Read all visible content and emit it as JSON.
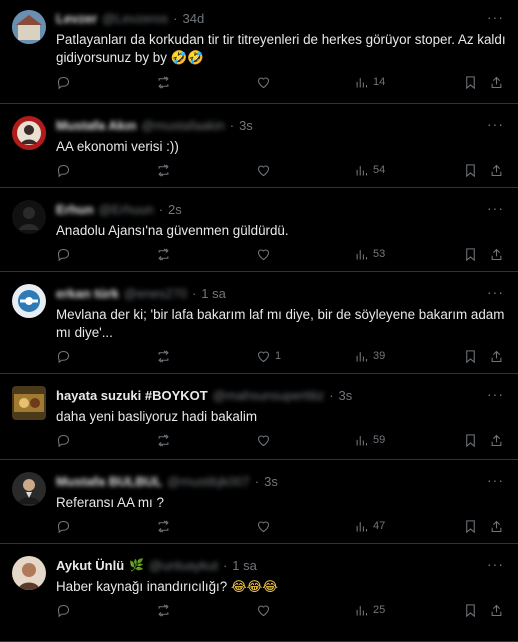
{
  "tweets": [
    {
      "name": "Levzer",
      "handle": "@Levzeros",
      "time": "34d",
      "text": "Patlayanları da korkudan tir tir titreyenleri de herkes görüyor stoper. Az kaldı gidiyorsunuz by by",
      "emoji": "🤣🤣",
      "likes": "",
      "views": "14",
      "avatar_color": "#3b5d7a"
    },
    {
      "name": "Mustafa Akın",
      "handle": "@mustafaakin",
      "time": "3s",
      "text": "AA ekonomi verisi :))",
      "emoji": "",
      "likes": "",
      "views": "54",
      "avatar_color": "#b11b1b"
    },
    {
      "name": "Erhun",
      "handle": "@Erhuun",
      "time": "2s",
      "text": "Anadolu Ajansı'na güvenmen güldürdü.",
      "emoji": "",
      "likes": "",
      "views": "53",
      "avatar_color": "#1a1a1a"
    },
    {
      "name": "erkan türk",
      "handle": "@enes270",
      "time": "1 sa",
      "text": "Mevlana der ki; 'bir lafa bakarım laf mı diye, bir de söyleyene bakarım adam mı diye'...",
      "emoji": "",
      "likes": "1",
      "views": "39",
      "avatar_color": "#2c7ab8"
    },
    {
      "name": "hayata suzuki #BOYKOT",
      "handle": "@mahsunsupertitiz",
      "time": "3s",
      "text": "daha yeni basliyoruz hadi bakalim",
      "emoji": "",
      "likes": "",
      "views": "59",
      "avatar_color": "#8a6a2a"
    },
    {
      "name": "Mustafa BULBUL",
      "handle": "@mustibjk007",
      "time": "3s",
      "text": "Referansı AA mı ?",
      "emoji": "",
      "likes": "",
      "views": "47",
      "avatar_color": "#3a3a3a"
    },
    {
      "name": "Aykut Ünlü",
      "handle": "@unluaykut",
      "time": "1 sa",
      "text": "Haber kaynağı inandırıcılığı?",
      "emoji": "😂😂😂",
      "likes": "",
      "views": "25",
      "avatar_color": "#6b4a3a"
    }
  ]
}
